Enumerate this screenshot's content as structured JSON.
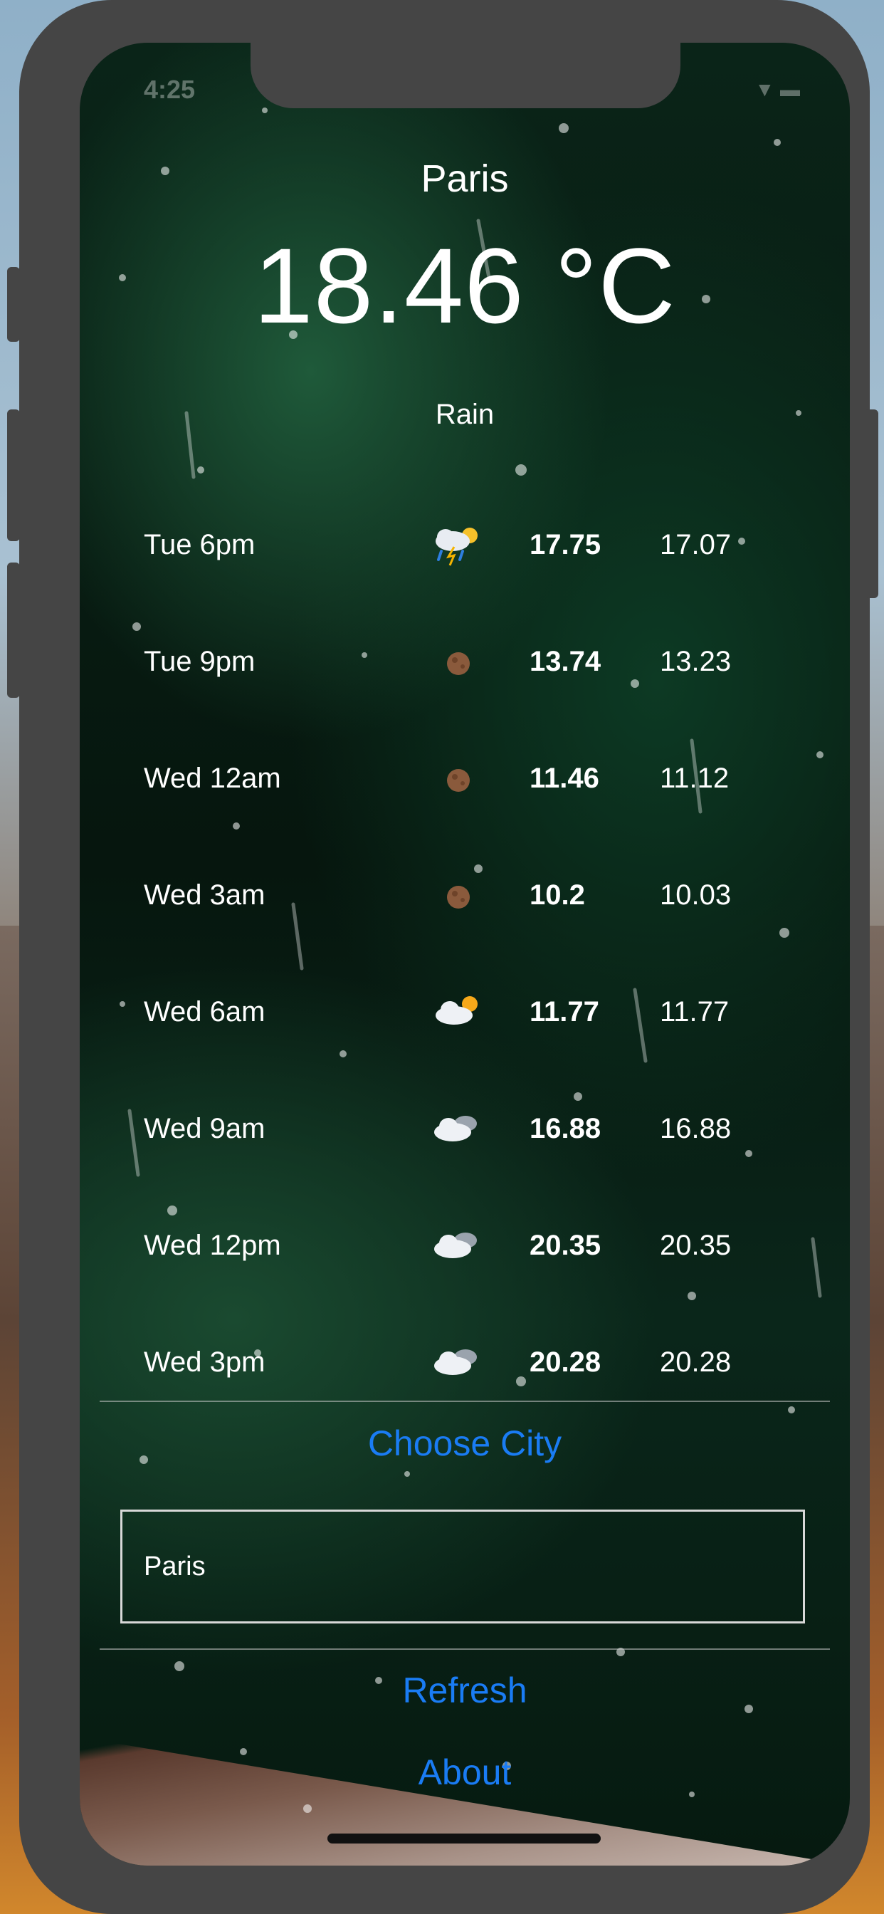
{
  "status_bar": {
    "time": "4:25"
  },
  "weather": {
    "city": "Paris",
    "temperature": "18.46 °C",
    "description": "Rain"
  },
  "forecast": [
    {
      "time": "Tue 6pm",
      "icon": "thunderstorm-rain-sun-icon",
      "high": "17.75",
      "low": "17.07"
    },
    {
      "time": "Tue 9pm",
      "icon": "moon-icon",
      "high": "13.74",
      "low": "13.23"
    },
    {
      "time": "Wed 12am",
      "icon": "moon-icon",
      "high": "11.46",
      "low": "11.12"
    },
    {
      "time": "Wed 3am",
      "icon": "moon-icon",
      "high": "10.2",
      "low": "10.03"
    },
    {
      "time": "Wed 6am",
      "icon": "cloud-sun-icon",
      "high": "11.77",
      "low": "11.77"
    },
    {
      "time": "Wed 9am",
      "icon": "cloud-icon",
      "high": "16.88",
      "low": "16.88"
    },
    {
      "time": "Wed 12pm",
      "icon": "cloud-icon",
      "high": "20.35",
      "low": "20.35"
    },
    {
      "time": "Wed 3pm",
      "icon": "cloud-icon",
      "high": "20.28",
      "low": "20.28"
    }
  ],
  "actions": {
    "choose_city": "Choose City",
    "city_input_value": "Paris",
    "refresh": "Refresh",
    "about": "About"
  },
  "colors": {
    "link": "#1a7cf4",
    "text": "#ffffff"
  }
}
